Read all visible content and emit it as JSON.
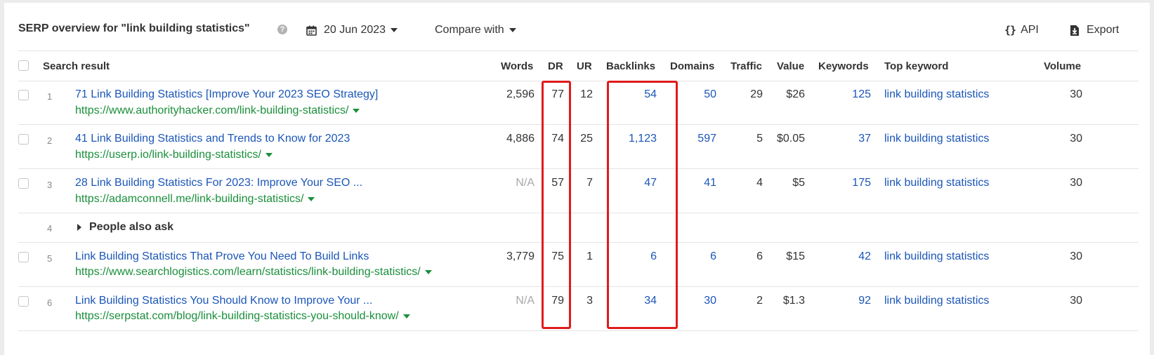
{
  "header": {
    "title": "SERP overview for \"link building statistics\"",
    "help_icon": "?",
    "date": "20 Jun 2023",
    "compare_label": "Compare with",
    "api_label": "API",
    "export_label": "Export"
  },
  "columns": {
    "search_result": "Search result",
    "words": "Words",
    "dr": "DR",
    "ur": "UR",
    "backlinks": "Backlinks",
    "domains": "Domains",
    "traffic": "Traffic",
    "value": "Value",
    "keywords": "Keywords",
    "top_keyword": "Top keyword",
    "volume": "Volume"
  },
  "rows": [
    {
      "pos": "1",
      "title": "71 Link Building Statistics [Improve Your 2023 SEO Strategy]",
      "url": "https://www.authorityhacker.com/link-building-statistics/",
      "words": "2,596",
      "dr": "77",
      "ur": "12",
      "backlinks": "54",
      "domains": "50",
      "traffic": "29",
      "value": "$26",
      "keywords": "125",
      "top_keyword": "link building statistics",
      "volume": "30"
    },
    {
      "pos": "2",
      "title": "41 Link Building Statistics and Trends to Know for 2023",
      "url": "https://userp.io/link-building-statistics/",
      "words": "4,886",
      "dr": "74",
      "ur": "25",
      "backlinks": "1,123",
      "domains": "597",
      "traffic": "5",
      "value": "$0.05",
      "keywords": "37",
      "top_keyword": "link building statistics",
      "volume": "30"
    },
    {
      "pos": "3",
      "title": "28 Link Building Statistics For 2023: Improve Your SEO ...",
      "url": "https://adamconnell.me/link-building-statistics/",
      "words": "N/A",
      "dr": "57",
      "ur": "7",
      "backlinks": "47",
      "domains": "41",
      "traffic": "4",
      "value": "$5",
      "keywords": "175",
      "top_keyword": "link building statistics",
      "volume": "30"
    },
    {
      "pos": "5",
      "title": "Link Building Statistics That Prove You Need To Build Links",
      "url": "https://www.searchlogistics.com/learn/statistics/link-building-statistics/",
      "words": "3,779",
      "dr": "75",
      "ur": "1",
      "backlinks": "6",
      "domains": "6",
      "traffic": "6",
      "value": "$15",
      "keywords": "42",
      "top_keyword": "link building statistics",
      "volume": "30"
    },
    {
      "pos": "6",
      "title": "Link Building Statistics You Should Know to Improve Your ...",
      "url": "https://serpstat.com/blog/link-building-statistics-you-should-know/",
      "words": "N/A",
      "dr": "79",
      "ur": "3",
      "backlinks": "34",
      "domains": "30",
      "traffic": "2",
      "value": "$1.3",
      "keywords": "92",
      "top_keyword": "link building statistics",
      "volume": "30"
    }
  ],
  "paa": {
    "pos": "4",
    "label": "People also ask"
  },
  "colors": {
    "link": "#1b56b8",
    "url": "#1a8f3b",
    "highlight": "#e01b1b"
  }
}
